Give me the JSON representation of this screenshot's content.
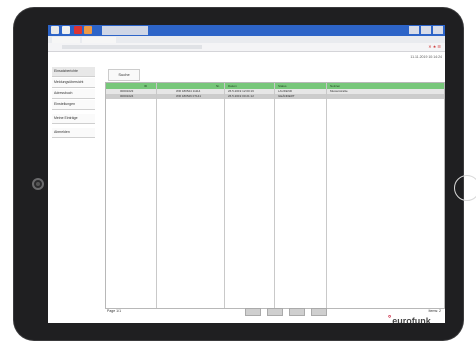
{
  "browser": {
    "tab_title": "",
    "tabs": [
      "",
      ""
    ],
    "url": ""
  },
  "datetime": "11.11.2019 10:14:24",
  "nav": {
    "items": [
      "Einsatzberichte",
      "Meldungsübersicht",
      "Adressbuch",
      "Einstellungen",
      "Meine Einträge",
      "Abmelden"
    ]
  },
  "search_tab": "Suche",
  "table": {
    "columns": [
      "ID",
      "Nr.",
      "Datum",
      "Status",
      "Notizen"
    ],
    "rows": [
      [
        "00001023",
        "WR 180524 11114",
        "26.5.2019 12:00:16",
        "LAUFEND",
        "Musterstraße"
      ],
      [
        "00001024",
        "WR 180526 07141",
        "26.5.2019 00:21:12",
        "GEÄNDERT",
        ""
      ]
    ]
  },
  "footer": {
    "page_label": "Page 1/1",
    "total_label": "Items: 2"
  },
  "logo": "eurofunk",
  "colors": {
    "header_green": "#77c77a",
    "titlebar_blue": "#2d64c8",
    "logo_red": "#c8102e"
  }
}
